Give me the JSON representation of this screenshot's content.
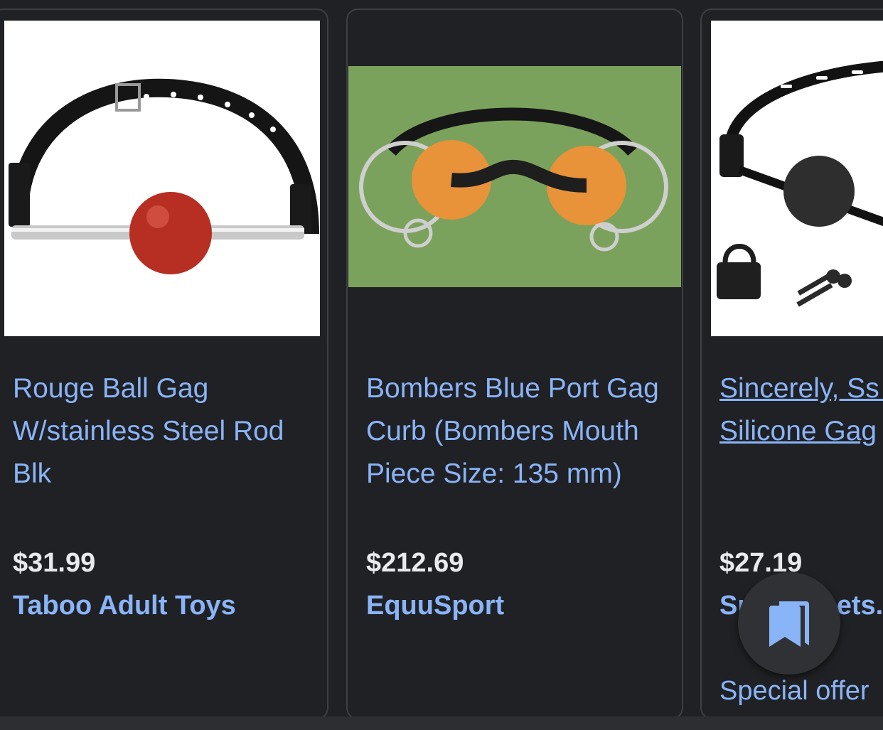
{
  "products": [
    {
      "title": "Rouge Ball Gag W/stainless Steel Rod Blk",
      "price": "$31.99",
      "seller": "Taboo Adult Toys",
      "image_alt": "Red ball gag on black leather strap with steel rod"
    },
    {
      "title": "Bombers Blue Port Gag Curb (Bombers Mouth Piece Size: 135 mm)",
      "price": "$212.69",
      "seller": "EquuSport",
      "image_alt": "Horse bit with orange discs on green background"
    },
    {
      "title": "Sincerely, Ss Lace Silicone Gag",
      "price": "$27.19",
      "seller": "Sportsheets.com",
      "offer": "Special offer",
      "image_alt": "Black silicone ball gag with padlock and keys"
    }
  ],
  "fab": {
    "icon": "bookmarks-icon"
  },
  "colors": {
    "background": "#202124",
    "link": "#8ab4f8",
    "price": "#e8eaed",
    "card_border": "#3c4043",
    "fab_background": "#303134"
  }
}
